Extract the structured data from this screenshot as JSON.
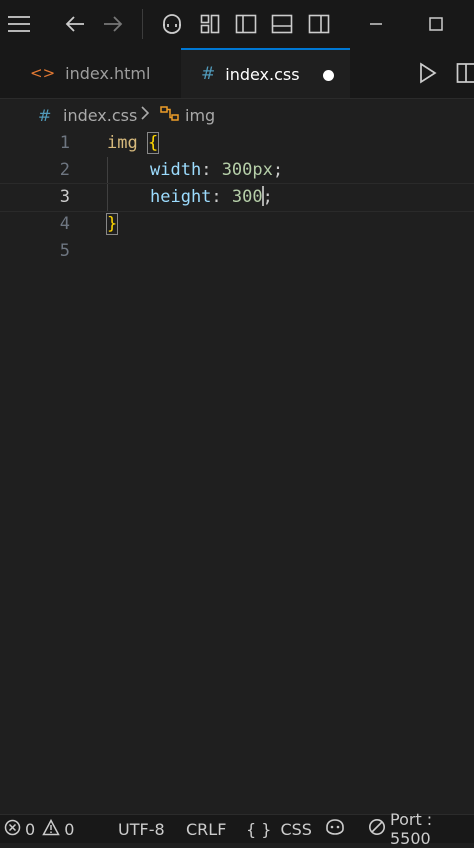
{
  "tabs": [
    {
      "label": "index.html",
      "icon": "html-file-icon",
      "icon_color": "#e37933",
      "active": false
    },
    {
      "label": "index.css",
      "icon": "css-file-icon",
      "icon_color": "#519aba",
      "active": true,
      "modified": true
    }
  ],
  "breadcrumb": {
    "file": "index.css",
    "symbol": "img"
  },
  "editor": {
    "line_numbers": [
      "1",
      "2",
      "3",
      "4",
      "5"
    ],
    "active_line": "3",
    "code": {
      "selector": "img",
      "open_brace": "{",
      "prop1": "width",
      "colon1": ":",
      "value1": "300px",
      "semi1": ";",
      "prop2": "height",
      "colon2": ":",
      "value2": "300",
      "semi2": ";",
      "close_brace": "}"
    }
  },
  "statusbar": {
    "errors": "0",
    "warnings": "0",
    "encoding": "UTF-8",
    "eol": "CRLF",
    "language": "CSS",
    "port": "Port : 5500"
  },
  "colors": {
    "accent": "#0078d4",
    "background": "#1f1f1f"
  }
}
